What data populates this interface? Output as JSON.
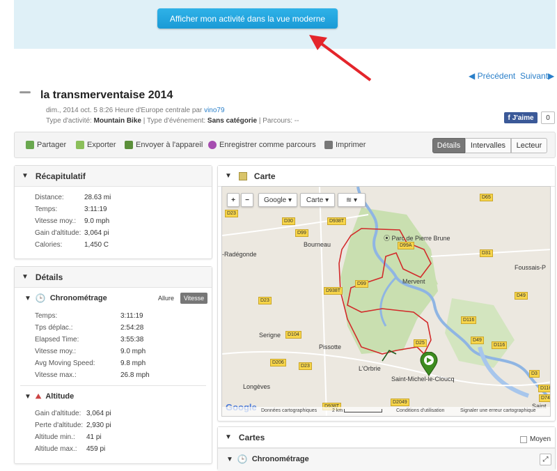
{
  "banner": {
    "modern_view_button": "Afficher mon activité dans la vue moderne"
  },
  "nav": {
    "previous": "Précédent",
    "next": "Suivant"
  },
  "activity": {
    "title": "la transmerventaise 2014",
    "date_line": "dim., 2014 oct. 5 8:26 Heure d'Europe centrale par",
    "author": "vino79",
    "type_label": "Type d'activité:",
    "type_value": "Mountain Bike",
    "event_label": "| Type d'événement:",
    "event_value": "Sans catégorie",
    "course_label": "| Parcours: --"
  },
  "social": {
    "like_label": "J'aime",
    "like_count": "0"
  },
  "toolbar": {
    "share": "Partager",
    "export": "Exporter",
    "send": "Envoyer à l'appareil",
    "save_course": "Enregistrer comme parcours",
    "print": "Imprimer",
    "tabs": [
      "Détails",
      "Intervalles",
      "Lecteur"
    ]
  },
  "summary": {
    "title": "Récapitulatif",
    "rows": [
      {
        "label": "Distance:",
        "value": "28.63 mi"
      },
      {
        "label": "Temps:",
        "value": "3:11:19"
      },
      {
        "label": "Vitesse moy.:",
        "value": "9.0 mph"
      },
      {
        "label": "Gain d'altitude:",
        "value": "3,064 pi"
      },
      {
        "label": "Calories:",
        "value": "1,450 C"
      }
    ]
  },
  "details": {
    "title": "Détails",
    "timing": {
      "title": "Chronométrage",
      "toggle_pace": "Allure",
      "toggle_speed": "Vitesse",
      "rows": [
        {
          "label": "Temps:",
          "value": "3:11:19"
        },
        {
          "label": "Tps déplac.:",
          "value": "2:54:28"
        },
        {
          "label": "Elapsed Time:",
          "value": "3:55:38"
        },
        {
          "label": "Vitesse moy.:",
          "value": "9.0 mph"
        },
        {
          "label": "Avg Moving Speed:",
          "value": "9.8 mph"
        },
        {
          "label": "Vitesse max.:",
          "value": "26.8 mph"
        }
      ]
    },
    "altitude": {
      "title": "Altitude",
      "rows": [
        {
          "label": "Gain d'altitude:",
          "value": "3,064 pi"
        },
        {
          "label": "Perte d'altitude:",
          "value": "2,930 pi"
        },
        {
          "label": "Altitude min.:",
          "value": "41 pi"
        },
        {
          "label": "Altitude max.:",
          "value": "459 pi"
        }
      ]
    }
  },
  "map_panel": {
    "title": "Carte",
    "provider": "Google",
    "map_type": "Carte",
    "places": [
      "Bourneau",
      "Parc de Pierre Brune",
      "Mervent",
      "Foussais-P",
      "-Radégonde",
      "Serigne",
      "Pissotte",
      "L'Orbrie",
      "Saint-Michel-le-Cloucq",
      "Longèves",
      "Saint"
    ],
    "roads": [
      "D23",
      "D30",
      "D938T",
      "D99",
      "D65",
      "D99A",
      "D31",
      "D938T",
      "D99",
      "D49",
      "D23",
      "D104",
      "D116",
      "D49",
      "D116",
      "D25",
      "D206",
      "D23",
      "D3",
      "D116",
      "D74",
      "D938T",
      "D2049"
    ],
    "google_logo": "Google",
    "attribution": "Données cartographiques",
    "scale": "2 km",
    "terms": "Conditions d'utilisation",
    "report": "Signaler une erreur cartographique"
  },
  "charts_panel": {
    "title": "Cartes",
    "average_label": "Moyen",
    "timing_title": "Chronométrage"
  }
}
